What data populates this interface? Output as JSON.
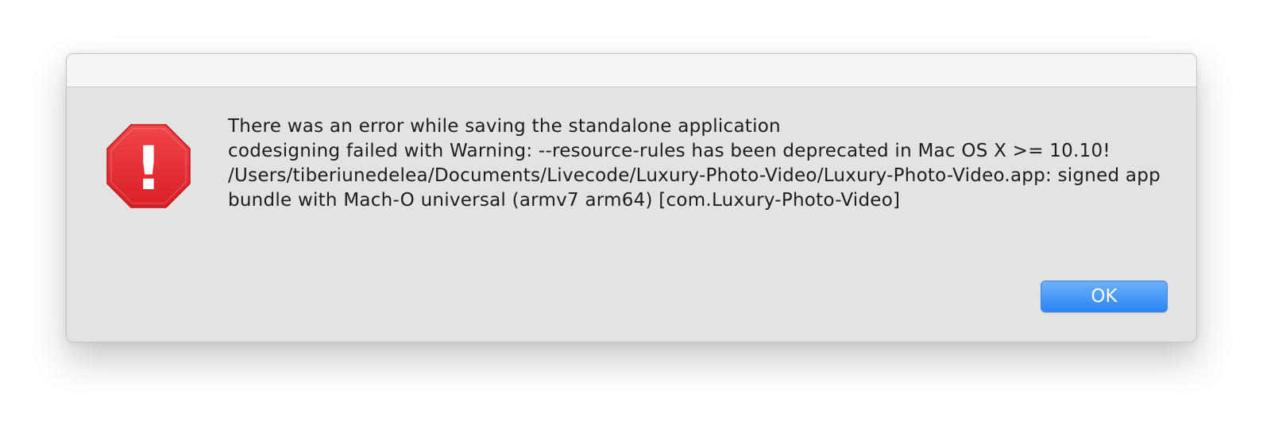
{
  "alert": {
    "icon": "stop-alert-icon",
    "icon_glyph": "!",
    "icon_color": "#e52a2f",
    "message_lines": [
      "There was an error while saving the standalone application",
      "codesigning failed with Warning: --resource-rules has been deprecated in Mac OS X >= 10.10!",
      "/Users/tiberiunedelea/Documents/Livecode/Luxury-Photo-Video/Luxury-Photo-Video.app: signed app bundle with Mach-O universal (armv7 arm64) [com.Luxury-Photo-Video]"
    ],
    "ok_label": "OK",
    "accent_color": "#2a85f3"
  }
}
